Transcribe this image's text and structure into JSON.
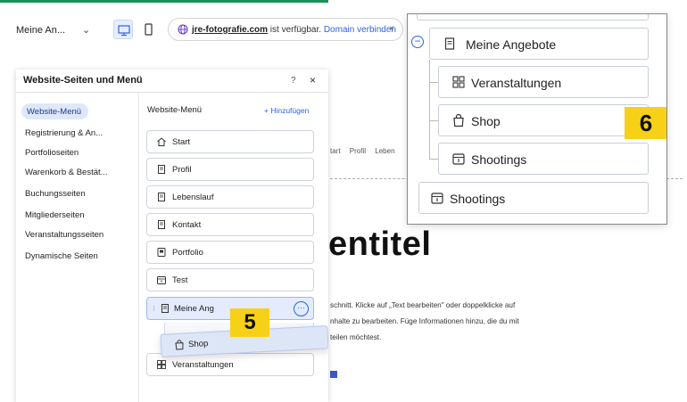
{
  "topbar": {
    "page_select": "Meine An...",
    "domain": "jre-fotografie.com",
    "domain_status": " ist verfügbar.",
    "connect_link": "Domain verbinden"
  },
  "panel": {
    "title": "Website-Seiten und Menü",
    "help": "?",
    "sidebar": [
      "Website-Menü",
      "Registrierung & An...",
      "Portfolioseiten",
      "Warenkorb & Bestät...",
      "Buchungsseiten",
      "Mitgliederseiten",
      "Veranstaltungsseiten",
      "Dynamische Seiten"
    ],
    "main_header": "Website-Menü",
    "add_label": "+ Hinzufügen",
    "pages": [
      "Start",
      "Profil",
      "Lebenslauf",
      "Kontakt",
      "Portfolio",
      "Test",
      "Meine Ang",
      "Veranstaltungen"
    ],
    "dragging_item": "Shop",
    "step_badge": "5"
  },
  "site": {
    "nav": [
      "tart",
      "Profil",
      "Leben"
    ],
    "headline": "entitel",
    "body_lines": [
      "schnitt. Klicke auf „Text bearbeiten\" oder doppelklicke auf",
      "nhalte zu bearbeiten. Füge Informationen hinzu, die du mit",
      "teilen möchtest."
    ]
  },
  "inset": {
    "parent": "Meine Angebote",
    "children": [
      "Veranstaltungen",
      "Shop",
      "Shootings"
    ],
    "sibling": "Shootings",
    "step_badge": "6"
  },
  "colors": {
    "accent": "#2d63e8",
    "badge": "#f7d117",
    "selected_bg": "#e3ebfd",
    "green_line": "#1a8f5a"
  },
  "icons": {
    "start": "home-icon",
    "page": "page-icon",
    "portfolio": "portfolio-icon",
    "test": "calendar-icon",
    "shop": "shopping-bag-icon",
    "events": "events-icon",
    "bookings": "calendar-icon"
  }
}
